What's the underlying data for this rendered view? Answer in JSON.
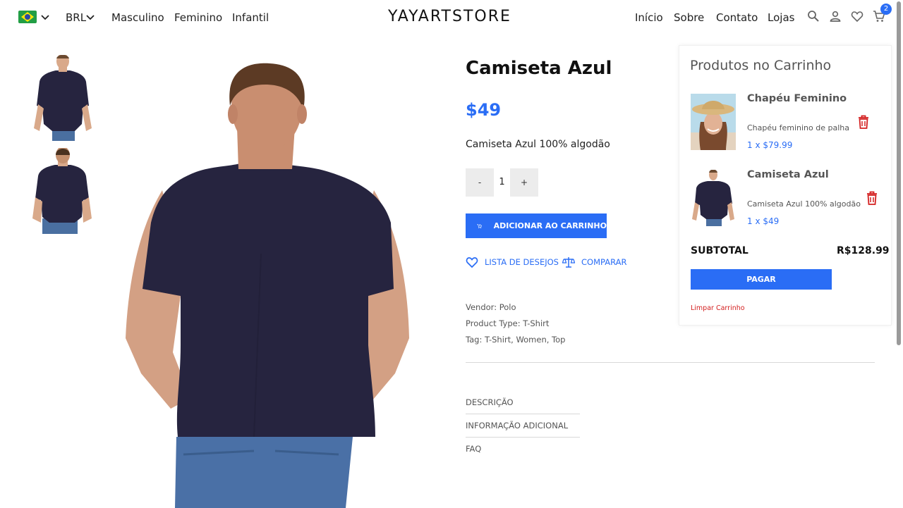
{
  "header": {
    "currency": "BRL",
    "nav_left": [
      "Masculino",
      "Feminino",
      "Infantil"
    ],
    "logo": "YAYARTSTORE",
    "nav_right": [
      "Início",
      "Sobre",
      "Contato",
      "Lojas"
    ],
    "cart_count": "2",
    "icons": [
      "brazil-flag-icon",
      "search-icon",
      "user-icon",
      "heart-icon",
      "cart-icon"
    ]
  },
  "product": {
    "title": "Camiseta Azul",
    "price": "$49",
    "description": "Camiseta Azul 100% algodão",
    "qty_minus": "-",
    "quantity": "1",
    "qty_plus": "+",
    "add_to_cart": "ADICIONAR AO CARRINHO",
    "wishlist": "LISTA DE DESEJOS",
    "compare": "COMPARAR",
    "meta": [
      {
        "label": "Vendor:",
        "value": "Polo"
      },
      {
        "label": "Product Type:",
        "value": "T-Shirt"
      },
      {
        "label": "Tag:",
        "value": "T-Shirt, Women, Top"
      }
    ],
    "tabs": [
      "DESCRIÇÃO",
      "INFORMAÇÃO ADICIONAL",
      "FAQ"
    ]
  },
  "cart": {
    "heading": "Produtos no Carrinho",
    "items": [
      {
        "name": "Chapéu Feminino",
        "desc": "Chapéu feminino de palha",
        "qty_price": "1 x $79.99"
      },
      {
        "name": "Camiseta Azul",
        "desc": "Camiseta Azul 100% algodão",
        "qty_price": "1 x $49"
      }
    ],
    "subtotal_label": "SUBTOTAL",
    "subtotal_value": "R$128.99",
    "pay": "PAGAR",
    "clear": "Limpar Carrinho"
  },
  "colors": {
    "accent": "#2a6df5",
    "danger": "#d42020",
    "shirt": "#26243f"
  }
}
